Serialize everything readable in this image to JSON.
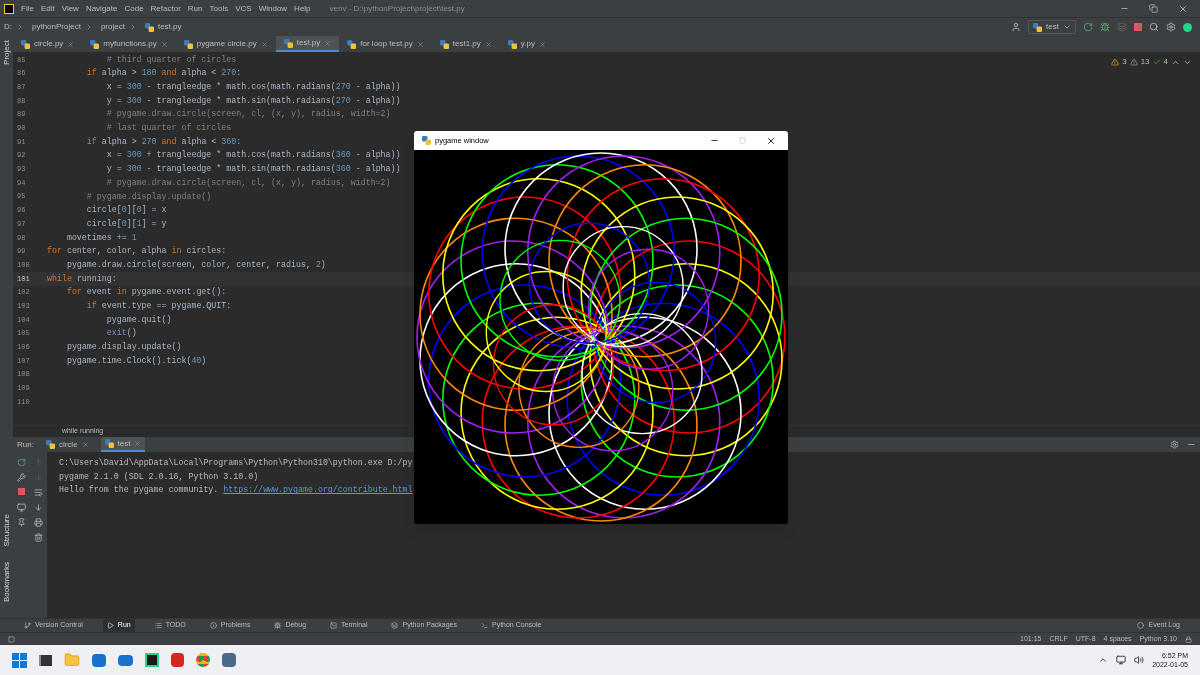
{
  "menu": [
    "File",
    "Edit",
    "View",
    "Navigate",
    "Code",
    "Refactor",
    "Run",
    "Tools",
    "VCS",
    "Window",
    "Help"
  ],
  "window_title": "venv - D:\\pythonProject\\project\\test.py",
  "breadcrumbs": [
    "D:",
    "pythonProject",
    "project",
    "test.py"
  ],
  "run_config": "test",
  "editor_tabs": [
    {
      "label": "circle.py",
      "selected": false
    },
    {
      "label": "myfunctions.py",
      "selected": false
    },
    {
      "label": "pygame circle.py",
      "selected": false
    },
    {
      "label": "test.py",
      "selected": true
    },
    {
      "label": "for loop test.py",
      "selected": false
    },
    {
      "label": "test1.py",
      "selected": false
    },
    {
      "label": "y.py",
      "selected": false
    }
  ],
  "left_tools": [
    "Project"
  ],
  "left_tools_bottom": [
    "Structure",
    "Bookmarks"
  ],
  "inspections": {
    "errors": "3",
    "warnings": "13",
    "ok": "4"
  },
  "code_lines": [
    {
      "number": "85",
      "current": false,
      "tokens": [
        {
          "text": "            # third quarter of circles",
          "kind": "comment"
        }
      ]
    },
    {
      "number": "86",
      "current": false,
      "tokens": [
        {
          "text": "        if ",
          "kind": "keyword"
        },
        {
          "text": "alpha > ",
          "kind": "plain"
        },
        {
          "text": "180",
          "kind": "number"
        },
        {
          "text": " and ",
          "kind": "keyword"
        },
        {
          "text": "alpha < ",
          "kind": "plain"
        },
        {
          "text": "270",
          "kind": "number"
        },
        {
          "text": ":",
          "kind": "plain"
        }
      ]
    },
    {
      "number": "87",
      "current": false,
      "tokens": [
        {
          "text": "            x = ",
          "kind": "plain"
        },
        {
          "text": "300",
          "kind": "number"
        },
        {
          "text": " - trangleedge * math.cos(math.radians(",
          "kind": "plain"
        },
        {
          "text": "270",
          "kind": "number"
        },
        {
          "text": " - alpha))",
          "kind": "plain"
        }
      ]
    },
    {
      "number": "88",
      "current": false,
      "tokens": [
        {
          "text": "            y = ",
          "kind": "plain"
        },
        {
          "text": "300",
          "kind": "number"
        },
        {
          "text": " - trangleedge * math.sin(math.radians(",
          "kind": "plain"
        },
        {
          "text": "270",
          "kind": "number"
        },
        {
          "text": " - alpha))",
          "kind": "plain"
        }
      ]
    },
    {
      "number": "89",
      "current": false,
      "tokens": [
        {
          "text": "            # pygame.draw.circle(screen, cl, (x, y), radius, width=2)",
          "kind": "comment"
        }
      ]
    },
    {
      "number": "90",
      "current": false,
      "tokens": [
        {
          "text": "            # last quarter of circles",
          "kind": "comment"
        }
      ]
    },
    {
      "number": "91",
      "current": false,
      "tokens": [
        {
          "text": "        if ",
          "kind": "keyword"
        },
        {
          "text": "alpha > ",
          "kind": "plain"
        },
        {
          "text": "270",
          "kind": "number"
        },
        {
          "text": " and ",
          "kind": "keyword"
        },
        {
          "text": "alpha < ",
          "kind": "plain"
        },
        {
          "text": "360",
          "kind": "number"
        },
        {
          "text": ":",
          "kind": "plain"
        }
      ]
    },
    {
      "number": "92",
      "current": false,
      "tokens": [
        {
          "text": "            x = ",
          "kind": "plain"
        },
        {
          "text": "300",
          "kind": "number"
        },
        {
          "text": " + trangleedge * math.cos(math.radians(",
          "kind": "plain"
        },
        {
          "text": "360",
          "kind": "number"
        },
        {
          "text": " - alpha))",
          "kind": "plain"
        }
      ]
    },
    {
      "number": "93",
      "current": false,
      "tokens": [
        {
          "text": "            y = ",
          "kind": "plain"
        },
        {
          "text": "300",
          "kind": "number"
        },
        {
          "text": " - trangleedge * math.sin(math.radians(",
          "kind": "plain"
        },
        {
          "text": "360",
          "kind": "number"
        },
        {
          "text": " - alpha))",
          "kind": "plain"
        }
      ]
    },
    {
      "number": "94",
      "current": false,
      "tokens": [
        {
          "text": "            # pygame.draw.circle(screen, cl, (x, y), radius, width=2)",
          "kind": "comment"
        }
      ]
    },
    {
      "number": "95",
      "current": false,
      "tokens": [
        {
          "text": "        # pygame.display.update()",
          "kind": "comment"
        }
      ]
    },
    {
      "number": "96",
      "current": false,
      "tokens": [
        {
          "text": "        circle[",
          "kind": "plain"
        },
        {
          "text": "0",
          "kind": "number"
        },
        {
          "text": "][",
          "kind": "plain"
        },
        {
          "text": "0",
          "kind": "number"
        },
        {
          "text": "] = x",
          "kind": "plain"
        }
      ]
    },
    {
      "number": "97",
      "current": false,
      "tokens": [
        {
          "text": "        circle[",
          "kind": "plain"
        },
        {
          "text": "0",
          "kind": "number"
        },
        {
          "text": "][",
          "kind": "plain"
        },
        {
          "text": "1",
          "kind": "number"
        },
        {
          "text": "] = y",
          "kind": "plain"
        }
      ]
    },
    {
      "number": "98",
      "current": false,
      "tokens": [
        {
          "text": "    movetimes += ",
          "kind": "plain"
        },
        {
          "text": "1",
          "kind": "number"
        }
      ]
    },
    {
      "number": "99",
      "current": false,
      "tokens": [
        {
          "text": "for",
          "kind": "keyword"
        },
        {
          "text": " center, color, alpha ",
          "kind": "plain"
        },
        {
          "text": "in",
          "kind": "keyword"
        },
        {
          "text": " circles:",
          "kind": "plain"
        }
      ]
    },
    {
      "number": "100",
      "current": false,
      "tokens": [
        {
          "text": "    pygame.draw.circle(screen, color, center, radius, ",
          "kind": "plain"
        },
        {
          "text": "2",
          "kind": "number"
        },
        {
          "text": ")",
          "kind": "plain"
        }
      ]
    },
    {
      "number": "101",
      "current": true,
      "tokens": [
        {
          "text": "while",
          "kind": "keyword"
        },
        {
          "text": " running:",
          "kind": "plain"
        }
      ]
    },
    {
      "number": "102",
      "current": false,
      "tokens": [
        {
          "text": "    for",
          "kind": "keyword"
        },
        {
          "text": " event ",
          "kind": "plain"
        },
        {
          "text": "in",
          "kind": "keyword"
        },
        {
          "text": " pygame.event.get():",
          "kind": "plain"
        }
      ]
    },
    {
      "number": "103",
      "current": false,
      "tokens": [
        {
          "text": "        if",
          "kind": "keyword"
        },
        {
          "text": " event.type == pygame.QUIT:",
          "kind": "plain"
        }
      ]
    },
    {
      "number": "104",
      "current": false,
      "tokens": [
        {
          "text": "            pygame.quit()",
          "kind": "plain"
        }
      ]
    },
    {
      "number": "105",
      "current": false,
      "tokens": [
        {
          "text": "            exit",
          "kind": "builtin"
        },
        {
          "text": "()",
          "kind": "plain"
        }
      ]
    },
    {
      "number": "106",
      "current": false,
      "tokens": [
        {
          "text": "    pygame.display.update()",
          "kind": "plain"
        }
      ]
    },
    {
      "number": "107",
      "current": false,
      "tokens": [
        {
          "text": "    pygame.time.Clock().tick(",
          "kind": "plain"
        },
        {
          "text": "40",
          "kind": "number"
        },
        {
          "text": ")",
          "kind": "plain"
        }
      ]
    },
    {
      "number": "108",
      "current": false
    },
    {
      "number": "109",
      "current": false
    },
    {
      "number": "110",
      "current": false
    }
  ],
  "code_breadcrumb": "while running",
  "run_panel": {
    "label": "Run:",
    "tabs": [
      {
        "label": "circle",
        "selected": false
      },
      {
        "label": "test",
        "selected": true
      }
    ],
    "output": [
      {
        "text": "C:\\Users\\David\\AppData\\Local\\Programs\\Python\\Python310\\python.exe D:/py"
      },
      {
        "text": "pygame 2.1.0 (SDL 2.0.16, Python 3.10.0)"
      },
      {
        "text": "Hello from the pygame community. ",
        "link": "https://www.pygame.org/contribute.html"
      }
    ]
  },
  "pygame_window": {
    "title": "pygame window"
  },
  "tool_tabs": [
    {
      "label": "Version Control",
      "selected": false
    },
    {
      "label": "Run",
      "selected": true
    },
    {
      "label": "TODO",
      "selected": false
    },
    {
      "label": "Problems",
      "selected": false
    },
    {
      "label": "Debug",
      "selected": false
    },
    {
      "label": "Terminal",
      "selected": false
    },
    {
      "label": "Python Packages",
      "selected": false
    },
    {
      "label": "Python Console",
      "selected": false
    }
  ],
  "event_log": "Event Log",
  "status": [
    "101:15",
    "CRLF",
    "UTF-8",
    "4 spaces",
    "Python 3.10"
  ],
  "clock": {
    "time": "6:52 PM",
    "date": "2022-01-05"
  }
}
